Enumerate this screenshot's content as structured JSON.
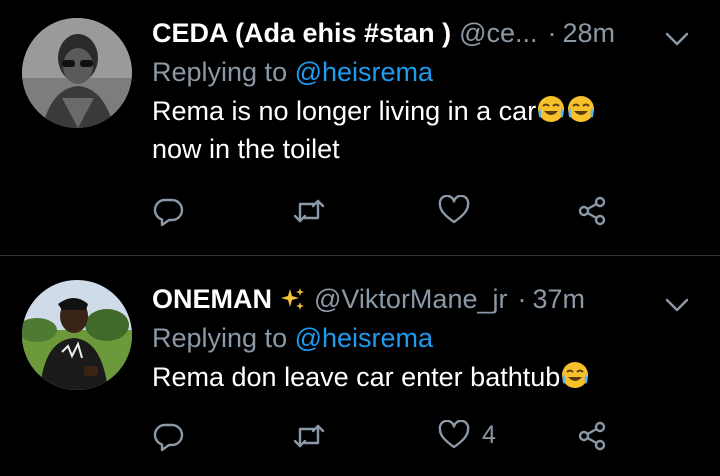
{
  "tweets": [
    {
      "name": "CEDA (Ada ehis #stan )",
      "handle": "@ce...",
      "separator": "·",
      "time": "28m",
      "replying_prefix": "Replying to",
      "replying_to": "@heisrema",
      "text_line1": "Rema is no longer living in a car",
      "text_line2": "now in the toilet",
      "like_count": ""
    },
    {
      "name": "ONEMAN",
      "name_emoji": "sparkles-icon",
      "handle": "@ViktorMane_jr",
      "separator": "·",
      "time": "37m",
      "replying_prefix": "Replying to",
      "replying_to": "@heisrema",
      "text_line1": "Rema don leave car enter bathtub",
      "like_count": "4"
    }
  ],
  "colors": {
    "background": "#000000",
    "text": "#ffffff",
    "secondary": "#8b98a5",
    "link": "#1d9bf0"
  }
}
